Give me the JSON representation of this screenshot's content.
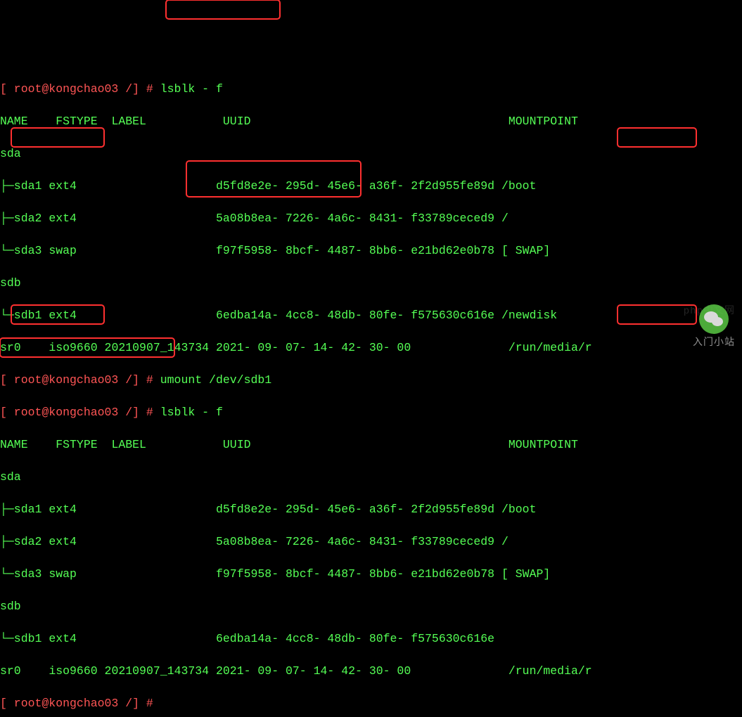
{
  "prompts": {
    "p1": "[ root@kongchao03 /] # ",
    "p2": "[ root@kongchao03 /] # ",
    "p3": "[ root@kongchao03 /] # ",
    "p4": "[ root@kongchao03 /] #"
  },
  "cmds": {
    "cmd1": "lsblk - f",
    "cmd2": "umount /dev/sdb1",
    "cmd3": "lsblk - f"
  },
  "cols": {
    "name": "NAME",
    "fstype": "FSTYPE",
    "label": "LABEL",
    "uuid": "UUID",
    "mountpoint": "MOUNTPOINT"
  },
  "rows1": {
    "sda": {
      "name": "sda",
      "fstype": "",
      "label": "",
      "uuid": "",
      "mp": ""
    },
    "sda1": {
      "name": "├─sda1",
      "fstype": "ext4",
      "label": "",
      "uuid": "d5fd8e2e- 295d- 45e6- a36f- 2f2d955fe89d",
      "mp": "/boot"
    },
    "sda2": {
      "name": "├─sda2",
      "fstype": "ext4",
      "label": "",
      "uuid": "5a08b8ea- 7226- 4a6c- 8431- f33789ceced9",
      "mp": "/"
    },
    "sda3": {
      "name": "└─sda3",
      "fstype": "swap",
      "label": "",
      "uuid": "f97f5958- 8bcf- 4487- 8bb6- e21bd62e0b78",
      "mp": "[ SWAP]"
    },
    "sdb": {
      "name": "sdb",
      "fstype": "",
      "label": "",
      "uuid": "",
      "mp": ""
    },
    "sdb1": {
      "name": "└─sdb1",
      "fstype": "ext4",
      "label": "",
      "uuid": "6edba14a- 4cc8- 48db- 80fe- f575630c616e",
      "mp": "/newdisk"
    },
    "sr0": {
      "name": "sr0",
      "fstype": "iso9660",
      "label": "20210907_143734",
      "uuid": "2021- 09- 07- 14- 42- 30- 00",
      "mp": "/run/media/r"
    }
  },
  "rows2": {
    "sda": {
      "name": "sda",
      "fstype": "",
      "label": "",
      "uuid": "",
      "mp": ""
    },
    "sda1": {
      "name": "├─sda1",
      "fstype": "ext4",
      "label": "",
      "uuid": "d5fd8e2e- 295d- 45e6- a36f- 2f2d955fe89d",
      "mp": "/boot"
    },
    "sda2": {
      "name": "├─sda2",
      "fstype": "ext4",
      "label": "",
      "uuid": "5a08b8ea- 7226- 4a6c- 8431- f33789ceced9",
      "mp": "/"
    },
    "sda3": {
      "name": "└─sda3",
      "fstype": "swap",
      "label": "",
      "uuid": "f97f5958- 8bcf- 4487- 8bb6- e21bd62e0b78",
      "mp": "[ SWAP]"
    },
    "sdb": {
      "name": "sdb",
      "fstype": "",
      "label": "",
      "uuid": "",
      "mp": ""
    },
    "sdb1": {
      "name": "└─sdb1",
      "fstype": "ext4",
      "label": "",
      "uuid": "6edba14a- 4cc8- 48db- 80fe- f575630c616e",
      "mp": ""
    },
    "sr0": {
      "name": "sr0",
      "fstype": "iso9660",
      "label": "20210907_143734",
      "uuid": "2021- 09- 07- 14- 42- 30- 00",
      "mp": "/run/media/r"
    }
  },
  "watermark": {
    "wechat_name": "入门小站",
    "php": "php中文网"
  },
  "colors": {
    "prompt": "#ff5555",
    "output": "#55ff55",
    "bg": "#000000"
  }
}
